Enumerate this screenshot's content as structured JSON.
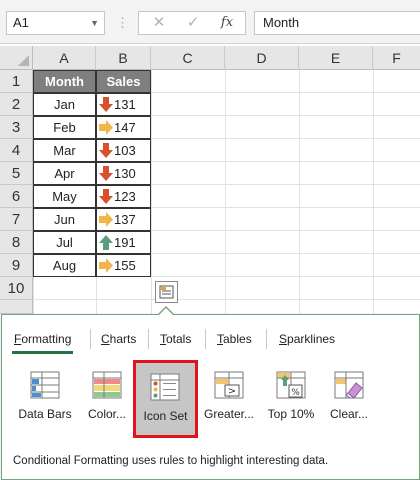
{
  "formula_bar": {
    "name_box": "A1",
    "cancel_glyph": "✕",
    "enter_glyph": "✓",
    "fx_glyph": "fx",
    "content": "Month"
  },
  "columns": [
    "A",
    "B",
    "C",
    "D",
    "E",
    "F"
  ],
  "rows": [
    "1",
    "2",
    "3",
    "4",
    "5",
    "6",
    "7",
    "8",
    "9",
    "10"
  ],
  "table": {
    "headers": [
      "Month",
      "Sales"
    ],
    "data": [
      {
        "month": "Jan",
        "sales": "131",
        "icon": "down"
      },
      {
        "month": "Feb",
        "sales": "147",
        "icon": "side"
      },
      {
        "month": "Mar",
        "sales": "103",
        "icon": "down"
      },
      {
        "month": "Apr",
        "sales": "130",
        "icon": "down"
      },
      {
        "month": "May",
        "sales": "123",
        "icon": "down"
      },
      {
        "month": "Jun",
        "sales": "137",
        "icon": "side"
      },
      {
        "month": "Jul",
        "sales": "191",
        "icon": "up"
      },
      {
        "month": "Aug",
        "sales": "155",
        "icon": "side"
      }
    ],
    "icon_colors": {
      "down": "#d9512c",
      "side": "#f1b54a",
      "up": "#5e9c80"
    }
  },
  "quick_analysis": {
    "button_icon": "quick-analysis-icon",
    "tabs": [
      {
        "pre": "",
        "ul": "F",
        "post": "ormatting",
        "active": true
      },
      {
        "pre": "",
        "ul": "C",
        "post": "harts",
        "active": false
      },
      {
        "pre": "",
        "ul": "T",
        "post": "otals",
        "active": false
      },
      {
        "pre": "",
        "ul": "T",
        "post": "ables",
        "active": false
      },
      {
        "pre": "",
        "ul": "S",
        "post": "parklines",
        "active": false
      }
    ],
    "options": [
      {
        "label": "Data Bars",
        "icon": "data-bars-icon"
      },
      {
        "label": "Color...",
        "icon": "color-scale-icon"
      },
      {
        "label": "Icon Set",
        "icon": "icon-set-icon",
        "selected": true
      },
      {
        "label": "Greater...",
        "icon": "greater-than-icon"
      },
      {
        "label": "Top 10%",
        "icon": "top-10-percent-icon"
      },
      {
        "label": "Clear...",
        "icon": "clear-format-icon"
      }
    ],
    "description": "Conditional Formatting uses rules to highlight interesting data.",
    "accent_color": "#217346",
    "selection_outline": "#e0141e"
  }
}
